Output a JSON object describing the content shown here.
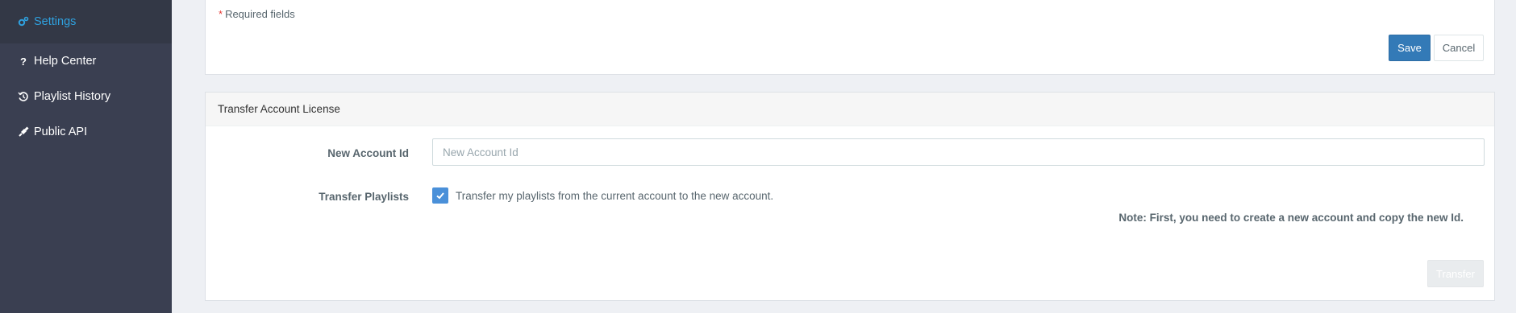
{
  "sidebar": {
    "items": [
      {
        "label": "Settings",
        "icon": "cogs-icon",
        "active": true
      },
      {
        "label": "Help Center",
        "icon": "question-icon"
      },
      {
        "label": "Playlist History",
        "icon": "history-icon"
      },
      {
        "label": "Public API",
        "icon": "plug-icon"
      }
    ]
  },
  "settings_form": {
    "required_star": "*",
    "required_text": "Required fields",
    "save_label": "Save",
    "cancel_label": "Cancel"
  },
  "transfer": {
    "title": "Transfer Account License",
    "account_label": "New Account Id",
    "account_placeholder": "New Account Id",
    "account_value": "",
    "playlists_label": "Transfer Playlists",
    "playlists_checked": true,
    "playlists_text": "Transfer my playlists from the current account to the new account.",
    "note": "Note: First, you need to create a new account and copy the new Id.",
    "transfer_label": "Transfer"
  },
  "colors": {
    "sidebar_bg": "#3a3f51",
    "active_accent": "#2fa1df",
    "primary": "#337ab7",
    "checkbox": "#4a90d9"
  }
}
